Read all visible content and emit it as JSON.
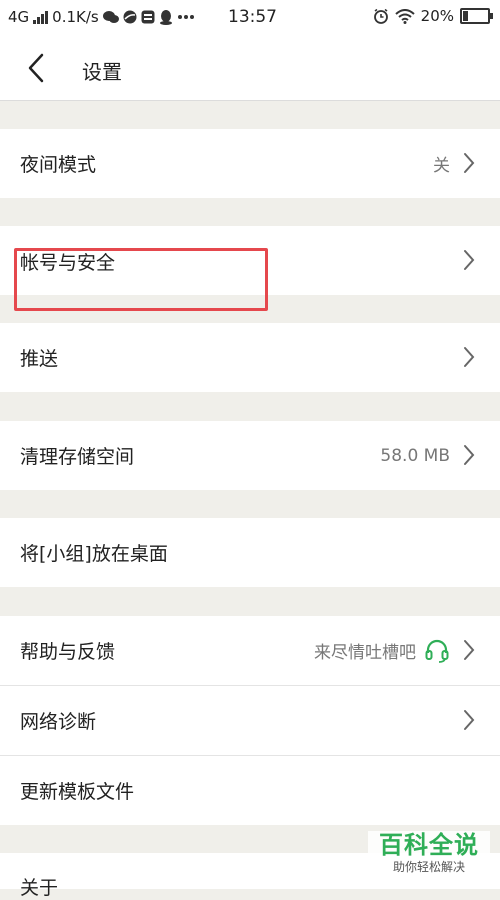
{
  "status_bar": {
    "network": "4G",
    "speed": "0.1K/s",
    "time": "13:57",
    "battery": "20%"
  },
  "header": {
    "title": "设置"
  },
  "settings": [
    {
      "label": "夜间模式",
      "value": "关"
    },
    {
      "label": "帐号与安全",
      "value": ""
    },
    {
      "label": "推送",
      "value": ""
    },
    {
      "label": "清理存储空间",
      "value": "58.0 MB"
    },
    {
      "label": "将[小组]放在桌面",
      "value": ""
    },
    {
      "label": "帮助与反馈",
      "value": "来尽情吐槽吧"
    },
    {
      "label": "网络诊断",
      "value": ""
    },
    {
      "label": "更新模板文件",
      "value": ""
    },
    {
      "label": "关于",
      "value": ""
    }
  ],
  "colors": {
    "highlight": "#e5484d",
    "headset": "#2fae57",
    "watermark": "#2fae57"
  },
  "watermark": {
    "title": "百科全说",
    "subtitle": "助你轻松解决"
  }
}
